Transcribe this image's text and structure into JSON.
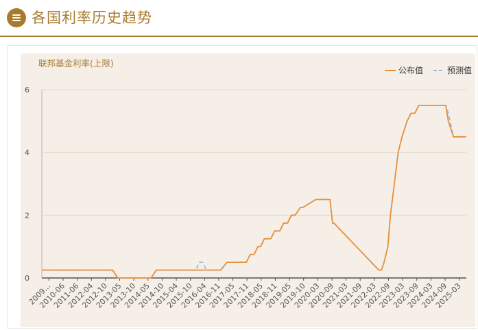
{
  "header": {
    "title": "各国利率历史趋势",
    "icon": "menu-icon"
  },
  "colors": {
    "accent": "#a87a2e",
    "published": "#e8903e",
    "forecast": "#9db8e0",
    "plot_bg": "#f6efe8"
  },
  "chart_data": {
    "type": "line",
    "title": "",
    "ylabel": "联邦基金利率(上限)",
    "xlabel": "",
    "ylim": [
      0,
      6
    ],
    "yticks": [
      "0",
      "2",
      "4",
      "6"
    ],
    "xticks": [
      "2009…",
      "2010-06",
      "2011-06",
      "2012-04",
      "2012-10",
      "2013-05",
      "2013-10",
      "2014-05",
      "2014-10",
      "2015-04",
      "2015-10",
      "2016-04",
      "2016-11",
      "2017-05",
      "2017-11",
      "2018-05",
      "2018-11",
      "2019-05",
      "2019-10",
      "2020-03",
      "2020-09",
      "2021-03",
      "2021-09",
      "2022-03",
      "2022-09",
      "2023-03",
      "2023-09",
      "2024-03",
      "2024-09",
      "2025-03"
    ],
    "legend_position": "top-right",
    "grid": true,
    "series": [
      {
        "name": "公布值",
        "style": "solid",
        "x": [
          2009.0,
          2011.75,
          2011.95,
          2013.25,
          2013.45,
          2015.95,
          2016.2,
          2016.95,
          2017.1,
          2017.25,
          2017.4,
          2017.5,
          2017.65,
          2017.9,
          2018.05,
          2018.25,
          2018.4,
          2018.55,
          2018.7,
          2018.85,
          2019.05,
          2019.15,
          2019.65,
          2019.95,
          2020.2,
          2020.3,
          2020.35,
          2022.1,
          2022.2,
          2022.3,
          2022.45,
          2022.55,
          2022.7,
          2022.85,
          2023.0,
          2023.2,
          2023.35,
          2023.5,
          2023.65,
          2024.7,
          2024.8,
          2025.0,
          2025.5
        ],
        "values": [
          0.25,
          0.25,
          0.0,
          0.0,
          0.25,
          0.25,
          0.5,
          0.5,
          0.75,
          0.75,
          1.0,
          1.0,
          1.25,
          1.25,
          1.5,
          1.5,
          1.75,
          1.75,
          2.0,
          2.0,
          2.25,
          2.25,
          2.5,
          2.5,
          2.5,
          1.75,
          1.75,
          0.25,
          0.25,
          0.5,
          1.0,
          2.0,
          3.0,
          4.0,
          4.5,
          5.0,
          5.25,
          5.25,
          5.5,
          5.5,
          5.0,
          4.5,
          4.5
        ]
      },
      {
        "name": "预测值",
        "style": "dashed",
        "x": [
          2009.0,
          2011.75,
          2011.95,
          2013.25,
          2013.45,
          2015.0,
          2015.1,
          2015.25,
          2015.4,
          2015.95,
          2016.2,
          2016.95,
          2017.1,
          2017.25,
          2017.4,
          2017.5,
          2017.65,
          2017.9,
          2018.05,
          2018.25,
          2018.4,
          2018.55,
          2018.7,
          2018.85,
          2019.05,
          2019.15,
          2019.65,
          2019.95,
          2020.2,
          2020.3,
          2020.35,
          2022.1,
          2022.2,
          2022.3,
          2022.45,
          2022.55,
          2022.7,
          2022.85,
          2023.0,
          2023.2,
          2023.35,
          2023.5,
          2023.65,
          2024.7,
          2024.8,
          2025.0,
          2025.5
        ],
        "values": [
          0.25,
          0.25,
          0.0,
          0.0,
          0.25,
          0.25,
          0.5,
          0.5,
          0.25,
          0.25,
          0.5,
          0.5,
          0.75,
          0.75,
          1.0,
          1.0,
          1.25,
          1.25,
          1.5,
          1.5,
          1.75,
          1.75,
          2.0,
          2.0,
          2.25,
          2.25,
          2.5,
          2.5,
          2.5,
          1.75,
          1.75,
          0.25,
          0.25,
          0.5,
          1.0,
          2.0,
          3.0,
          4.0,
          4.5,
          5.0,
          5.25,
          5.25,
          5.5,
          5.5,
          5.25,
          4.5,
          4.5
        ]
      }
    ]
  }
}
